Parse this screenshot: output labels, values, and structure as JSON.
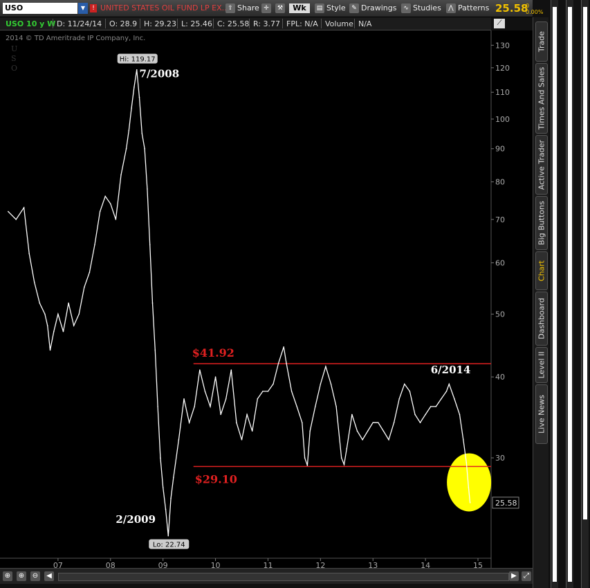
{
  "toolbar": {
    "symbol": "USO",
    "description": "UNITED STATES OIL FUND LP EX...",
    "share": "Share",
    "timeframe": "Wk",
    "style": "Style",
    "drawings": "Drawings",
    "studies": "Studies",
    "patterns": "Patterns",
    "last_price": "25.58",
    "change": "0",
    "change_pct": "0.00%"
  },
  "infobar": {
    "spec": "USO 10 y W",
    "date": "D: 11/24/14",
    "open": "O: 28.9",
    "high": "H: 29.23",
    "low": "L: 25.46",
    "close": "C: 25.58",
    "range": "R: 3.77",
    "fpl": "FPL: N/A",
    "volume": "Volume",
    "volume_value": "N/A"
  },
  "copyright": "2014 © TD Ameritrade IP Company, Inc.",
  "side_tabs": [
    "Trade",
    "Times And Sales",
    "Active Trader",
    "Big Buttons",
    "Chart",
    "Dashboard",
    "Level II",
    "Live News"
  ],
  "chart_data": {
    "type": "line",
    "scale": "log",
    "ylim": [
      21,
      135
    ],
    "yticks": [
      30,
      40,
      50,
      60,
      70,
      80,
      90,
      100,
      110,
      120,
      130
    ],
    "xlim": [
      2006.0,
      2015.25
    ],
    "xticks": [
      {
        "x": 2007,
        "label": "07"
      },
      {
        "x": 2008,
        "label": "08"
      },
      {
        "x": 2009,
        "label": "09"
      },
      {
        "x": 2010,
        "label": "10"
      },
      {
        "x": 2011,
        "label": "11"
      },
      {
        "x": 2012,
        "label": "12"
      },
      {
        "x": 2013,
        "label": "13"
      },
      {
        "x": 2014,
        "label": "14"
      },
      {
        "x": 2015,
        "label": "15"
      }
    ],
    "series": [
      {
        "color": "#ffffff",
        "points": [
          [
            2006.05,
            72
          ],
          [
            2006.2,
            70
          ],
          [
            2006.35,
            73
          ],
          [
            2006.45,
            62
          ],
          [
            2006.55,
            56
          ],
          [
            2006.65,
            52
          ],
          [
            2006.75,
            50
          ],
          [
            2006.8,
            48
          ],
          [
            2006.85,
            44
          ],
          [
            2006.92,
            47
          ],
          [
            2007.0,
            50
          ],
          [
            2007.1,
            47
          ],
          [
            2007.2,
            52
          ],
          [
            2007.3,
            48
          ],
          [
            2007.4,
            50
          ],
          [
            2007.5,
            55
          ],
          [
            2007.6,
            58
          ],
          [
            2007.7,
            64
          ],
          [
            2007.8,
            72
          ],
          [
            2007.9,
            76
          ],
          [
            2008.0,
            74
          ],
          [
            2008.1,
            70
          ],
          [
            2008.2,
            82
          ],
          [
            2008.3,
            90
          ],
          [
            2008.35,
            96
          ],
          [
            2008.4,
            104
          ],
          [
            2008.45,
            112
          ],
          [
            2008.5,
            119.17
          ],
          [
            2008.55,
            108
          ],
          [
            2008.6,
            95
          ],
          [
            2008.65,
            90
          ],
          [
            2008.7,
            78
          ],
          [
            2008.75,
            64
          ],
          [
            2008.8,
            52
          ],
          [
            2008.85,
            44
          ],
          [
            2008.9,
            36
          ],
          [
            2008.95,
            30
          ],
          [
            2009.0,
            27
          ],
          [
            2009.05,
            25
          ],
          [
            2009.1,
            22.74
          ],
          [
            2009.15,
            26
          ],
          [
            2009.2,
            28
          ],
          [
            2009.3,
            32
          ],
          [
            2009.4,
            37
          ],
          [
            2009.5,
            34
          ],
          [
            2009.6,
            36
          ],
          [
            2009.7,
            41
          ],
          [
            2009.8,
            38
          ],
          [
            2009.9,
            36
          ],
          [
            2010.0,
            40
          ],
          [
            2010.1,
            35
          ],
          [
            2010.2,
            37
          ],
          [
            2010.3,
            41
          ],
          [
            2010.4,
            34
          ],
          [
            2010.5,
            32
          ],
          [
            2010.6,
            35
          ],
          [
            2010.7,
            33
          ],
          [
            2010.8,
            37
          ],
          [
            2010.9,
            38
          ],
          [
            2011.0,
            38
          ],
          [
            2011.1,
            39
          ],
          [
            2011.2,
            42
          ],
          [
            2011.3,
            44.5
          ],
          [
            2011.35,
            42
          ],
          [
            2011.45,
            38
          ],
          [
            2011.55,
            36
          ],
          [
            2011.65,
            34
          ],
          [
            2011.7,
            30
          ],
          [
            2011.75,
            29.2
          ],
          [
            2011.8,
            33
          ],
          [
            2011.9,
            36
          ],
          [
            2012.0,
            39
          ],
          [
            2012.1,
            41.5
          ],
          [
            2012.2,
            39
          ],
          [
            2012.3,
            36
          ],
          [
            2012.4,
            30
          ],
          [
            2012.45,
            29.3
          ],
          [
            2012.5,
            31
          ],
          [
            2012.6,
            35
          ],
          [
            2012.7,
            33
          ],
          [
            2012.8,
            32
          ],
          [
            2012.9,
            33
          ],
          [
            2013.0,
            34
          ],
          [
            2013.1,
            34
          ],
          [
            2013.2,
            33
          ],
          [
            2013.3,
            32
          ],
          [
            2013.4,
            34
          ],
          [
            2013.5,
            37
          ],
          [
            2013.6,
            39
          ],
          [
            2013.7,
            38
          ],
          [
            2013.8,
            35
          ],
          [
            2013.9,
            34
          ],
          [
            2014.0,
            35
          ],
          [
            2014.1,
            36
          ],
          [
            2014.2,
            36
          ],
          [
            2014.3,
            37
          ],
          [
            2014.4,
            38
          ],
          [
            2014.45,
            39
          ],
          [
            2014.55,
            37
          ],
          [
            2014.65,
            35
          ],
          [
            2014.72,
            32
          ],
          [
            2014.78,
            29.5
          ],
          [
            2014.82,
            27
          ],
          [
            2014.85,
            25.58
          ]
        ]
      }
    ],
    "hlines": [
      {
        "value": 41.92,
        "label": "$41.92",
        "x_from": 2009.58
      },
      {
        "value": 29.1,
        "label": "$29.10",
        "x_from": 2009.58
      }
    ],
    "annotations": [
      {
        "text": "7/2008",
        "x": 2008.55,
        "y": 116
      },
      {
        "text": "2/2009",
        "x": 2008.1,
        "y": 23.8
      },
      {
        "text": "6/2014",
        "x": 2014.1,
        "y": 40.5
      },
      {
        "text": "Hi: 119.17",
        "x": 2008.5,
        "y": 119.17
      },
      {
        "text": "Lo: 22.74",
        "x": 2009.1,
        "y": 22.74
      }
    ],
    "highlight": {
      "x": 2014.83,
      "y": 27.5,
      "color": "#ffff00"
    },
    "last_value_label": "25.58"
  }
}
